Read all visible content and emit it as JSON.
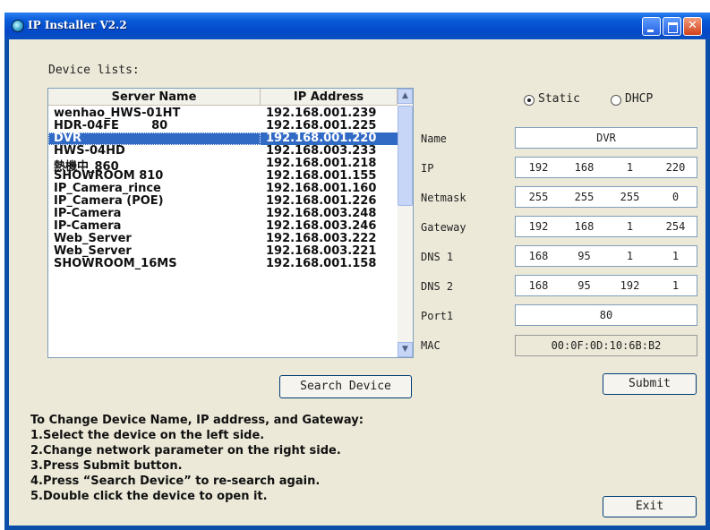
{
  "window": {
    "title": "IP Installer V2.2"
  },
  "device_list": {
    "label": "Device lists:",
    "columns": [
      "Server Name",
      "IP Address"
    ],
    "rows": [
      {
        "name": "wenhao_HWS-01HT",
        "ip": "192.168.001.239"
      },
      {
        "name": "HDR-04FE        80",
        "ip": "192.168.001.225"
      },
      {
        "name": "DVR",
        "ip": "192.168.001.220"
      },
      {
        "name": "HWS-04HD",
        "ip": "192.168.003.233"
      },
      {
        "name": "熱機中_860",
        "ip": "192.168.001.218"
      },
      {
        "name": "SHOWROOM 810",
        "ip": "192.168.001.155"
      },
      {
        "name": "IP_Camera_rince",
        "ip": "192.168.001.160"
      },
      {
        "name": "IP_Camera (POE)",
        "ip": "192.168.001.226"
      },
      {
        "name": "IP-Camera",
        "ip": "192.168.003.248"
      },
      {
        "name": "IP-Camera",
        "ip": "192.168.003.246"
      },
      {
        "name": "Web_Server",
        "ip": "192.168.003.222"
      },
      {
        "name": "Web_Server",
        "ip": "192.168.003.221"
      },
      {
        "name": "SHOWROOM_16MS",
        "ip": "192.168.001.158"
      }
    ],
    "selected_index": 2
  },
  "buttons": {
    "search": "Search Device",
    "submit": "Submit",
    "exit": "Exit"
  },
  "instructions": [
    "To Change Device Name, IP address, and Gateway:",
    "1.Select the device on the left side.",
    "2.Change network parameter on the right side.",
    "3.Press Submit button.",
    "4.Press “Search Device” to re-search again.",
    "5.Double click the device to open it."
  ],
  "mode": {
    "static_label": "Static",
    "dhcp_label": "DHCP",
    "selected": "Static"
  },
  "settings": {
    "name": {
      "label": "Name",
      "value": "DVR"
    },
    "ip": {
      "label": "IP",
      "octets": [
        "192",
        "168",
        "1",
        "220"
      ]
    },
    "netmask": {
      "label": "Netmask",
      "octets": [
        "255",
        "255",
        "255",
        "0"
      ]
    },
    "gateway": {
      "label": "Gateway",
      "octets": [
        "192",
        "168",
        "1",
        "254"
      ]
    },
    "dns1": {
      "label": "DNS 1",
      "octets": [
        "168",
        "95",
        "1",
        "1"
      ]
    },
    "dns2": {
      "label": "DNS 2",
      "octets": [
        "168",
        "95",
        "192",
        "1"
      ]
    },
    "port1": {
      "label": "Port1",
      "value": "80"
    },
    "mac": {
      "label": "MAC",
      "value": "00:0F:0D:10:6B:B2"
    }
  }
}
